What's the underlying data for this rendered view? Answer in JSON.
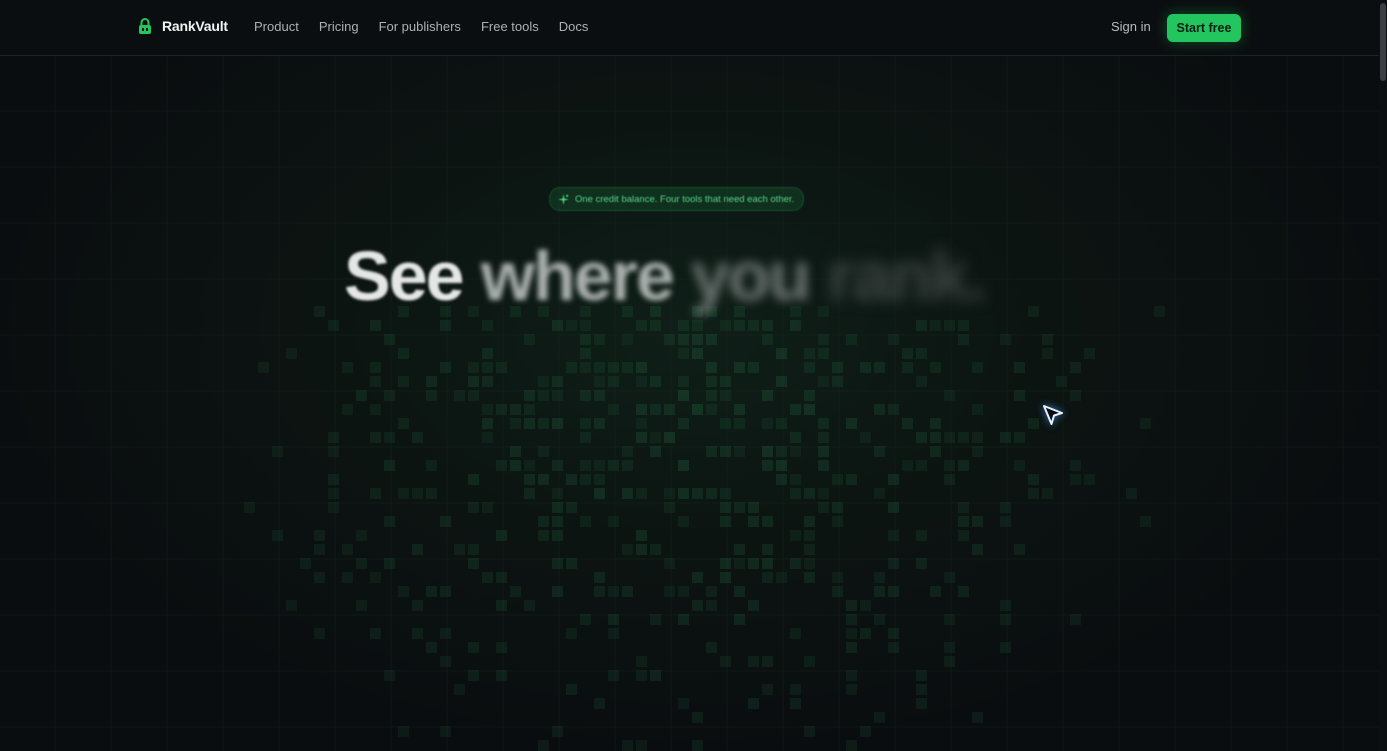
{
  "brand": {
    "name": "RankVault",
    "icon": "lock-icon",
    "accent": "#22c55e"
  },
  "nav": {
    "links": [
      "Product",
      "Pricing",
      "For publishers",
      "Free tools",
      "Docs"
    ],
    "signin": "Sign in",
    "cta": "Start free"
  },
  "hero": {
    "badge": {
      "icon": "sparkle-icon",
      "text": "One credit balance. Four tools that need each other."
    },
    "headline_words": [
      "See",
      "where",
      "you",
      "rank."
    ]
  },
  "colors": {
    "background": "#0a0d0f",
    "accent": "#22c55e",
    "headline": "#e4e7e6"
  }
}
